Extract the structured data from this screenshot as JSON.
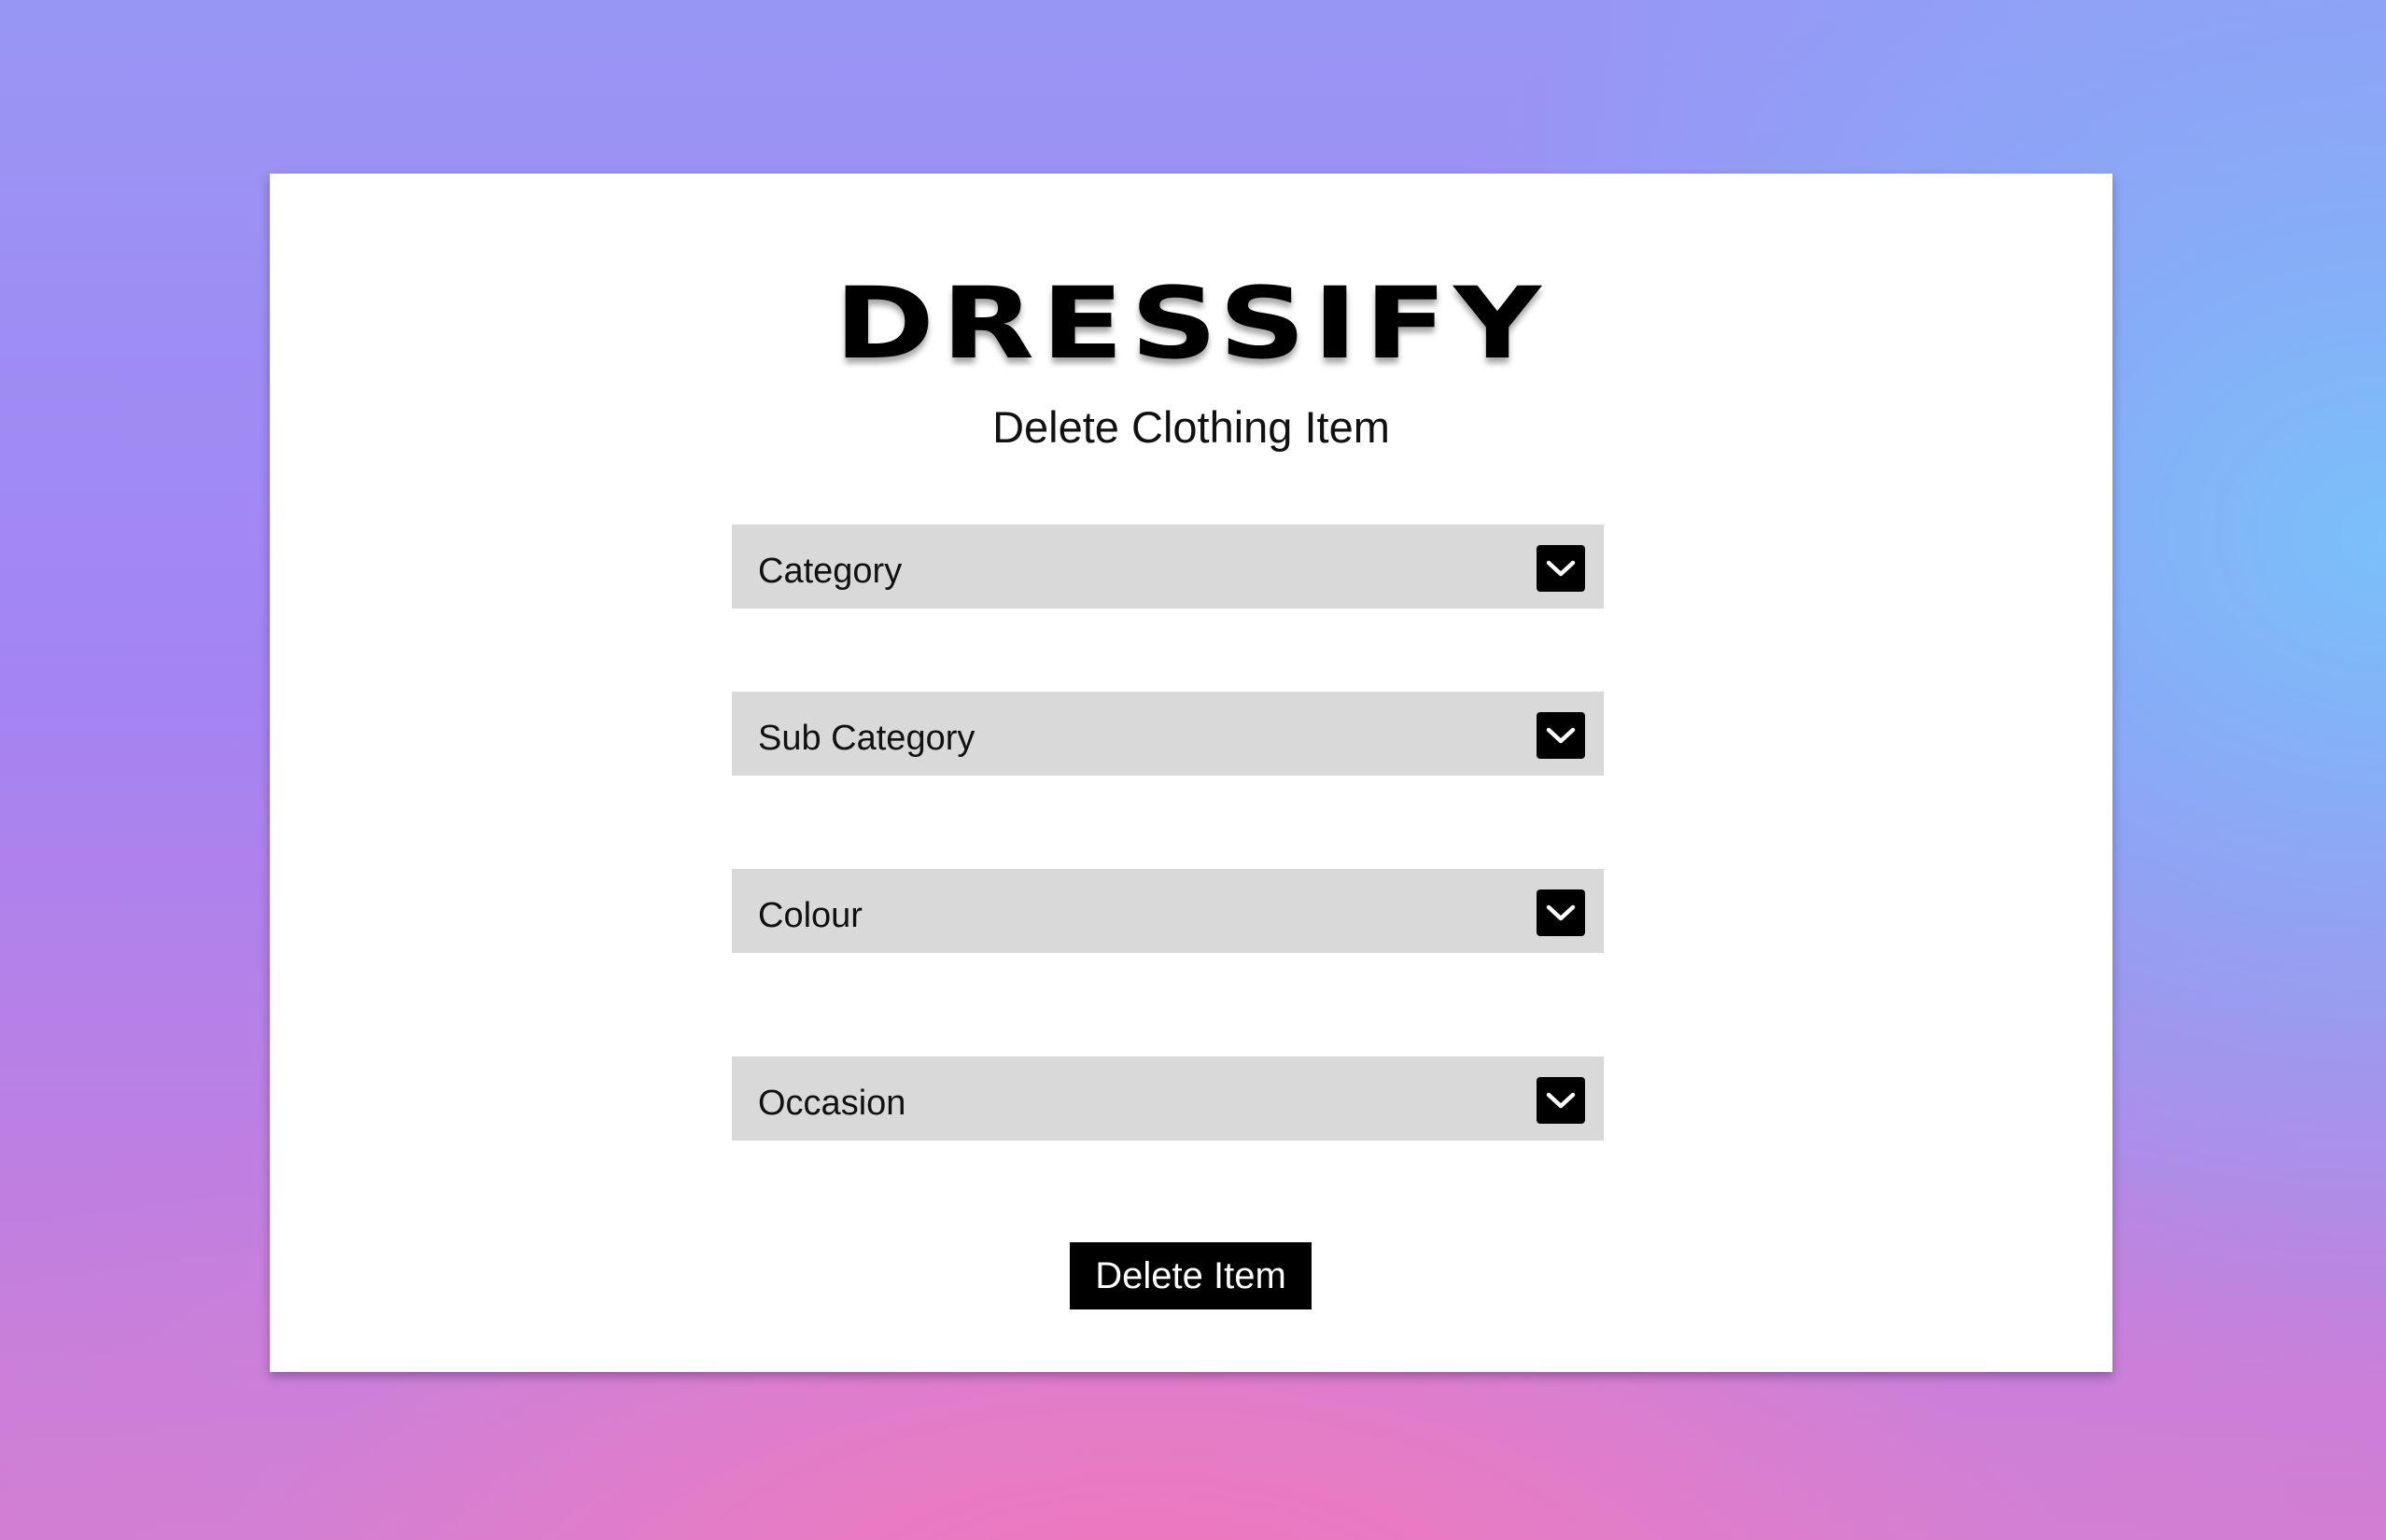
{
  "app": {
    "brand": "DRESSIFY",
    "page_title": "Delete Clothing Item"
  },
  "form": {
    "dropdowns": [
      {
        "label": "Category",
        "icon": "chevron-down-icon"
      },
      {
        "label": "Sub Category",
        "icon": "chevron-down-icon"
      },
      {
        "label": "Colour",
        "icon": "chevron-down-icon"
      },
      {
        "label": "Occasion",
        "icon": "chevron-down-icon"
      }
    ],
    "submit_label": "Delete Item"
  },
  "colors": {
    "card_background": "#ffffff",
    "dropdown_background": "#d9d9d9",
    "button_background": "#000000",
    "button_text": "#ffffff"
  }
}
